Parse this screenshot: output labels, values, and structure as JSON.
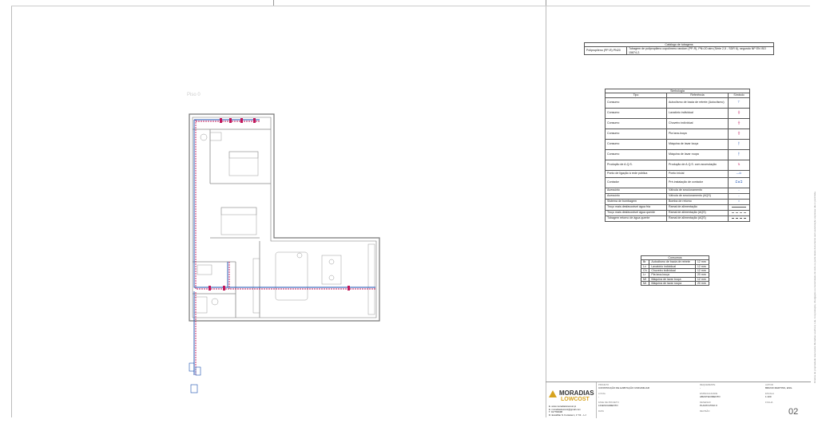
{
  "catalogo": {
    "title": "Catálogo de tubagens",
    "rows": [
      {
        "code": "Polipropileno (PP-R) PN20",
        "desc": "Tubagem de polipropileno copolímero random (PP-R), PN=20 atm (Série 2,5 - SDR 6), segundo NP EN ISO 15874-2."
      }
    ]
  },
  "simbologia": {
    "title": "Simbologia",
    "headers": [
      "Tipo",
      "Referência",
      "Símbolo"
    ],
    "rows": [
      {
        "tipo": "Consumo",
        "ref": "Autoclismo de bacia de retrete (Autoclismo)",
        "icon": "autoclismo-icon"
      },
      {
        "tipo": "Consumo",
        "ref": "Lavatório individual",
        "icon": "lavatorio-icon"
      },
      {
        "tipo": "Consumo",
        "ref": "Chuveiro individual",
        "icon": "chuveiro-icon"
      },
      {
        "tipo": "Consumo",
        "ref": "Pia lava-louça",
        "icon": "pia-icon"
      },
      {
        "tipo": "Consumo",
        "ref": "Máquina de lavar louça",
        "icon": "maquina-louca-icon"
      },
      {
        "tipo": "Consumo",
        "ref": "Máquina de lavar roupa",
        "icon": "maquina-roupa-icon"
      },
      {
        "tipo": "Produção de A.Q.S.",
        "ref": "Produção de A.Q.S. com acumulação",
        "icon": "acumulador-icon"
      },
      {
        "tipo": "Ponto de ligação à rede pública",
        "ref": "Ponto inicial",
        "icon": "ponto-inicial-icon"
      },
      {
        "tipo": "Contador",
        "ref": "Pré-instalação de contador",
        "icon": "contador-icon"
      },
      {
        "tipo": "Acessório",
        "ref": "Válvula de seccionamento",
        "icon": "valvula-icon"
      },
      {
        "tipo": "Acessório",
        "ref": "Válvula de seccionamento (AQS)",
        "icon": "valvula-aqs-icon"
      },
      {
        "tipo": "Sistema de bombagem",
        "ref": "Bomba de retorno",
        "icon": "bomba-icon"
      },
      {
        "tipo": "Troço mais desfavorável água fria",
        "ref": "Ramal de alimentação",
        "icon": "linha-fria-icon"
      },
      {
        "tipo": "Troço mais desfavorável água quente",
        "ref": "Ramal de alimentação (AQS)",
        "icon": "linha-quente-icon"
      },
      {
        "tipo": "Tubagem retorno de água quente",
        "ref": "Ramal de alimentação (AQS)",
        "icon": "linha-retorno-icon"
      }
    ]
  },
  "consumos": {
    "title": "Consumos",
    "rows": [
      {
        "code": "Br",
        "desc": "Autoclismo de bacia de retrete",
        "size": "12 mm"
      },
      {
        "code": "Lv",
        "desc": "Lavatório individual",
        "size": "12 mm"
      },
      {
        "code": "Ch",
        "desc": "Chuveiro individual",
        "size": "12 mm"
      },
      {
        "code": "Lr",
        "desc": "Pia lava-louça",
        "size": "20 mm"
      },
      {
        "code": "Ml",
        "desc": "Máquina de lavar louça",
        "size": "12 mm"
      },
      {
        "code": "Mr",
        "desc": "Máquina de lavar roupa",
        "size": "20 mm"
      }
    ]
  },
  "plan": {
    "floor_label": "Piso 0"
  },
  "titleblock": {
    "brand_top": "MORADIAS",
    "brand_bottom": "LOWCOST",
    "contacts": [
      "E. www.moradiaslowcost.pt",
      "E. moradiaslowcost@gmail.com",
      "T. 917784698",
      "R. Escalhão N. Fontelas 1, 1° Dt. - LJ"
    ],
    "projeto_label": "PROJETO",
    "projeto_value": "CONSTRUÇÃO DE HABITAÇÃO UNIFAMILIAR",
    "requerente_label": "REQUERENTE",
    "requerente_value": "-",
    "autor_label": "AUTOR",
    "autor_value": "BRUNO MARTINS, ENG.",
    "local_label": "LOCAL",
    "local_value": "-",
    "especialidade_label": "ESPECIALIDADE",
    "especialidade_value": "ABASTECIMENTO",
    "escala_label": "ESCALA",
    "escala_value": "1:100",
    "fase_label": "FASE DE PROJETO",
    "fase_value": "LICENCIAMENTO",
    "desenho_label": "DESENHO",
    "desenho_value": "PLANTA PISO 0",
    "folha_label": "FOLHA",
    "folha_value": "02",
    "data_label": "DATA",
    "revisao_label": "REVISÃO"
  },
  "side_note": "Direitos de propriedade reservados Moradias LowCost, Lda. A reprodução, divulgação ou transmissão de todo ou parte deste documento sem autorização expressa não é permitida."
}
